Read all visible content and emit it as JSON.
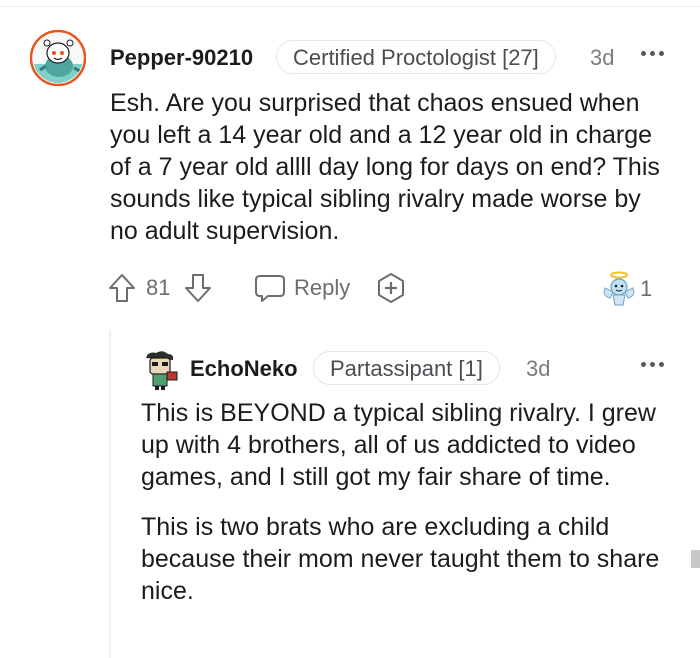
{
  "comment": {
    "author": "Pepper-90210",
    "flair": "Certified Proctologist [27]",
    "age": "3d",
    "body": "Esh. Are you surprised that chaos ensued when you left a 14 year old and a 12 year old in charge of a 7 year old allll day long for days on end? This sounds like typical sibling rivalry made worse by no adult supervision.",
    "upvotes": "81",
    "reply_label": "Reply",
    "award_count": "1"
  },
  "reply": {
    "author": "EchoNeko",
    "flair": "Partassipant [1]",
    "age": "3d",
    "paragraphs": [
      "This is BEYOND a typical sibling rivalry. I grew up with 4 brothers, all of us addicted to video games, and I still got my fair share of time.",
      "This is two brats who are excluding a child because their mom never taught them to share nice."
    ]
  },
  "colors": {
    "text": "#1c1c1c",
    "muted": "#6a6e72",
    "avatar_ring": "#e8541c",
    "avatar_bg": "#7fd0c8"
  }
}
